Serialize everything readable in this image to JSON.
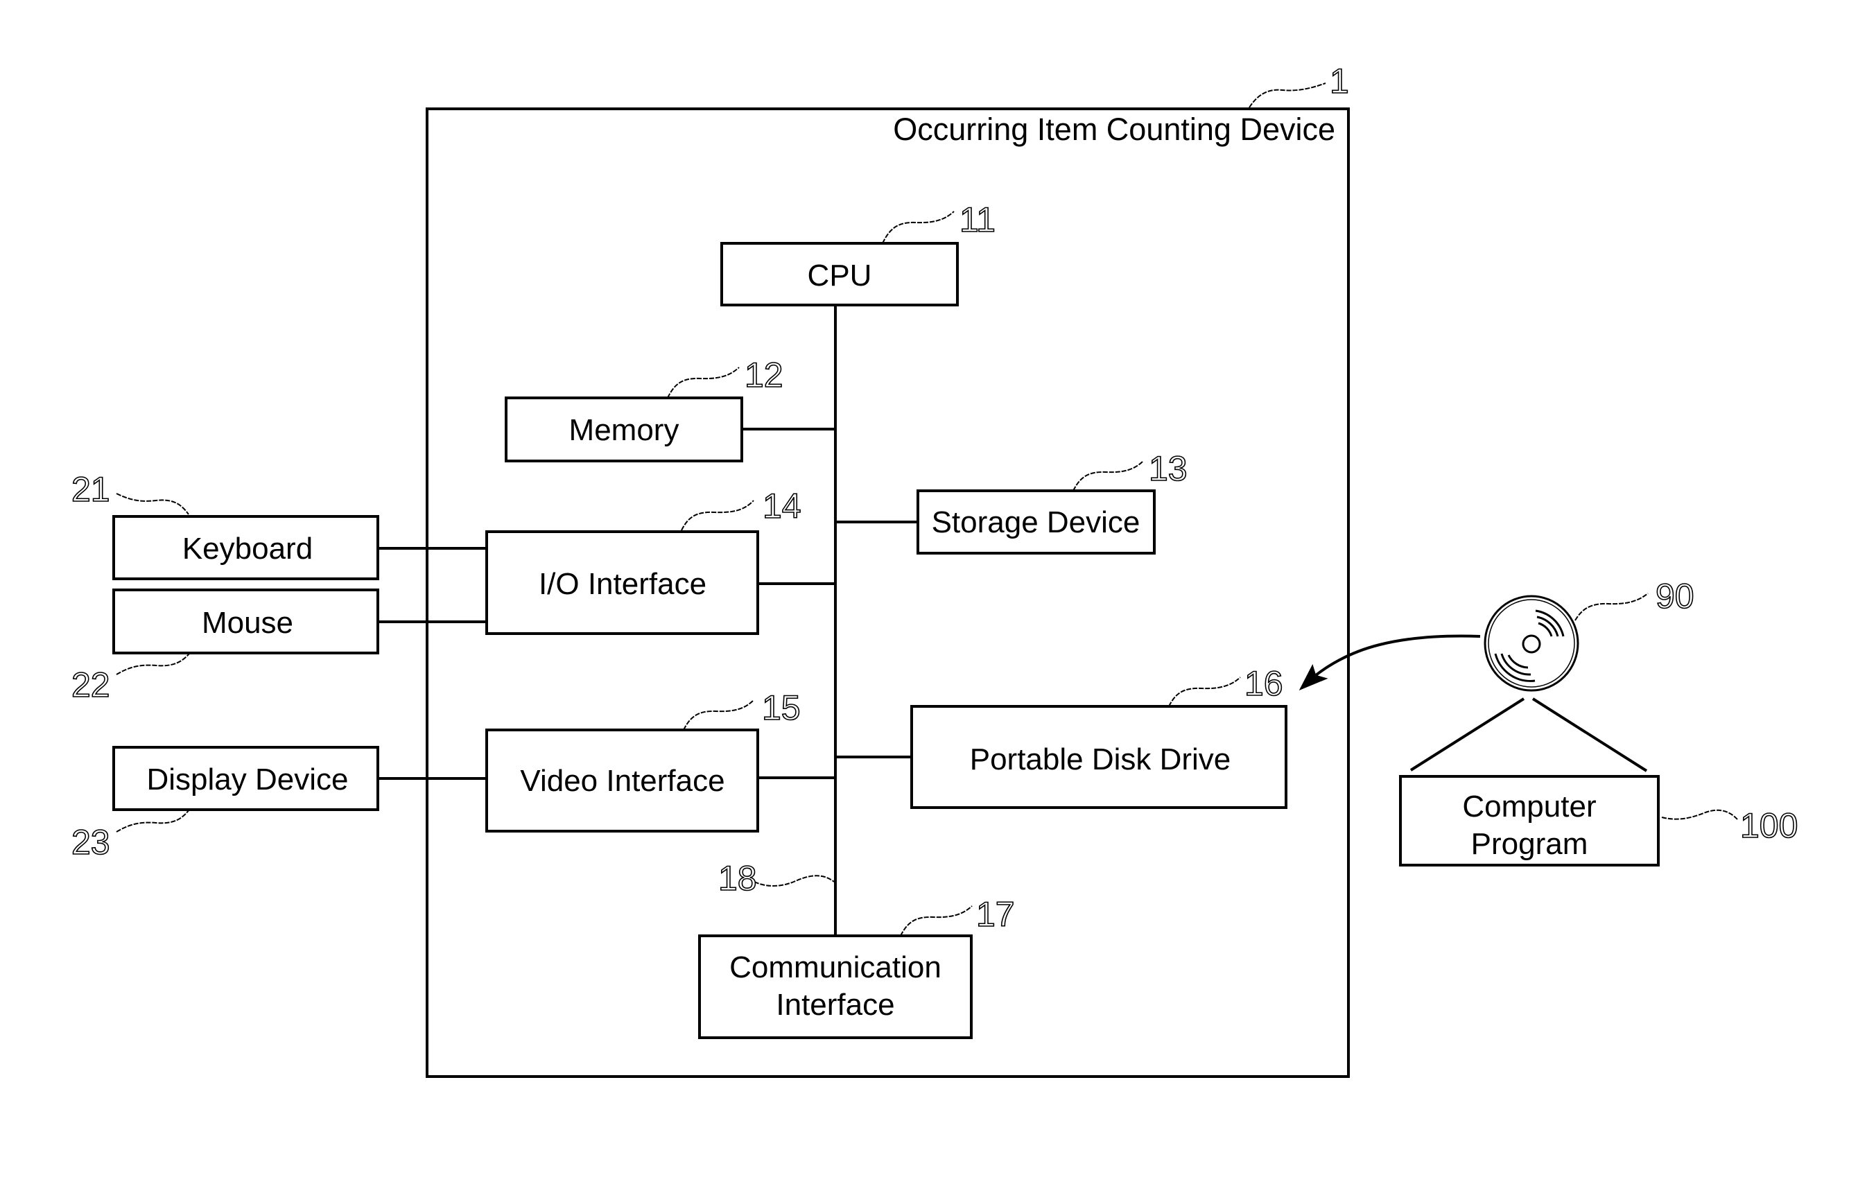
{
  "diagram": {
    "device": {
      "title": "Occurring Item Counting Device",
      "ref": "1"
    },
    "bus": {
      "ref": "18"
    },
    "components": {
      "cpu": {
        "label": "CPU",
        "ref": "11"
      },
      "memory": {
        "label": "Memory",
        "ref": "12"
      },
      "storage": {
        "label": "Storage Device",
        "ref": "13"
      },
      "io": {
        "label": "I/O Interface",
        "ref": "14"
      },
      "video": {
        "label": "Video Interface",
        "ref": "15"
      },
      "disk_drive": {
        "label": "Portable Disk Drive",
        "ref": "16"
      },
      "comm": {
        "label_line1": "Communication",
        "label_line2": "Interface",
        "ref": "17"
      }
    },
    "peripherals": {
      "keyboard": {
        "label": "Keyboard",
        "ref": "21"
      },
      "mouse": {
        "label": "Mouse",
        "ref": "22"
      },
      "display": {
        "label": "Display Device",
        "ref": "23"
      }
    },
    "media": {
      "disk": {
        "ref": "90",
        "icon": "optical-disc-icon"
      },
      "program": {
        "label_line1": "Computer",
        "label_line2": "Program",
        "ref": "100"
      }
    }
  }
}
